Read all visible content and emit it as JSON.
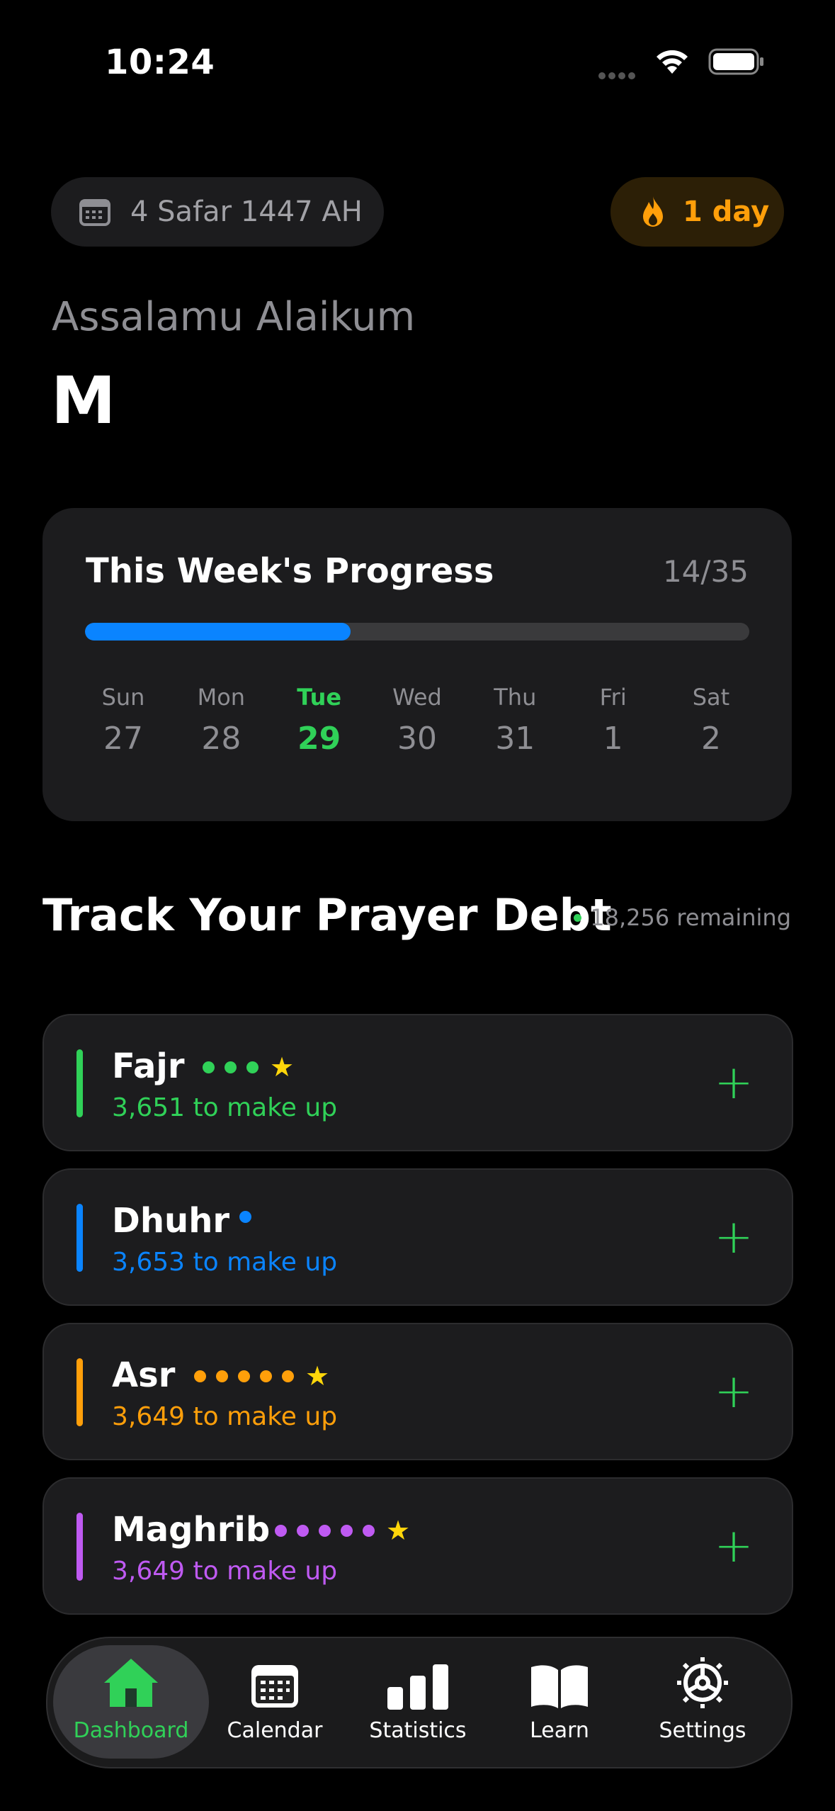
{
  "status_bar": {
    "time": "10:24"
  },
  "header": {
    "hijri_date": "4 Safar 1447 AH",
    "streak": "1 day",
    "greeting": "Assalamu Alaikum",
    "username": "M"
  },
  "weekly_progress": {
    "title": "This Week's Progress",
    "count": "14/35",
    "progress_fraction": 0.4,
    "days": [
      {
        "name": "Sun",
        "date": "27",
        "today": false
      },
      {
        "name": "Mon",
        "date": "28",
        "today": false
      },
      {
        "name": "Tue",
        "date": "29",
        "today": true
      },
      {
        "name": "Wed",
        "date": "30",
        "today": false
      },
      {
        "name": "Thu",
        "date": "31",
        "today": false
      },
      {
        "name": "Fri",
        "date": "1",
        "today": false
      },
      {
        "name": "Sat",
        "date": "2",
        "today": false
      }
    ]
  },
  "debt": {
    "title": "Track Your Prayer Debt",
    "remaining": "18,256 remaining",
    "prayers": [
      {
        "name": "Fajr",
        "sub": "3,651 to make up",
        "color": "#30d158",
        "dots": 3,
        "star": true
      },
      {
        "name": "Dhuhr",
        "sub": "3,653 to make up",
        "color": "#0a84ff",
        "dots": 1,
        "star": false
      },
      {
        "name": "Asr",
        "sub": "3,649 to make up",
        "color": "#ff9f0a",
        "dots": 5,
        "star": true
      },
      {
        "name": "Maghrib",
        "sub": "3,649 to make up",
        "color": "#bf5af2",
        "dots": 5,
        "star": true
      }
    ]
  },
  "tabs": [
    {
      "label": "Dashboard",
      "icon": "house-icon",
      "active": true
    },
    {
      "label": "Calendar",
      "icon": "calendar-icon",
      "active": false
    },
    {
      "label": "Statistics",
      "icon": "bar-chart-icon",
      "active": false
    },
    {
      "label": "Learn",
      "icon": "book-icon",
      "active": false
    },
    {
      "label": "Settings",
      "icon": "gear-icon",
      "active": false
    }
  ],
  "colors": {
    "accent": "#30d158",
    "progress": "#0a84ff",
    "streak": "#ff9f0a",
    "star": "#ffd60a"
  }
}
